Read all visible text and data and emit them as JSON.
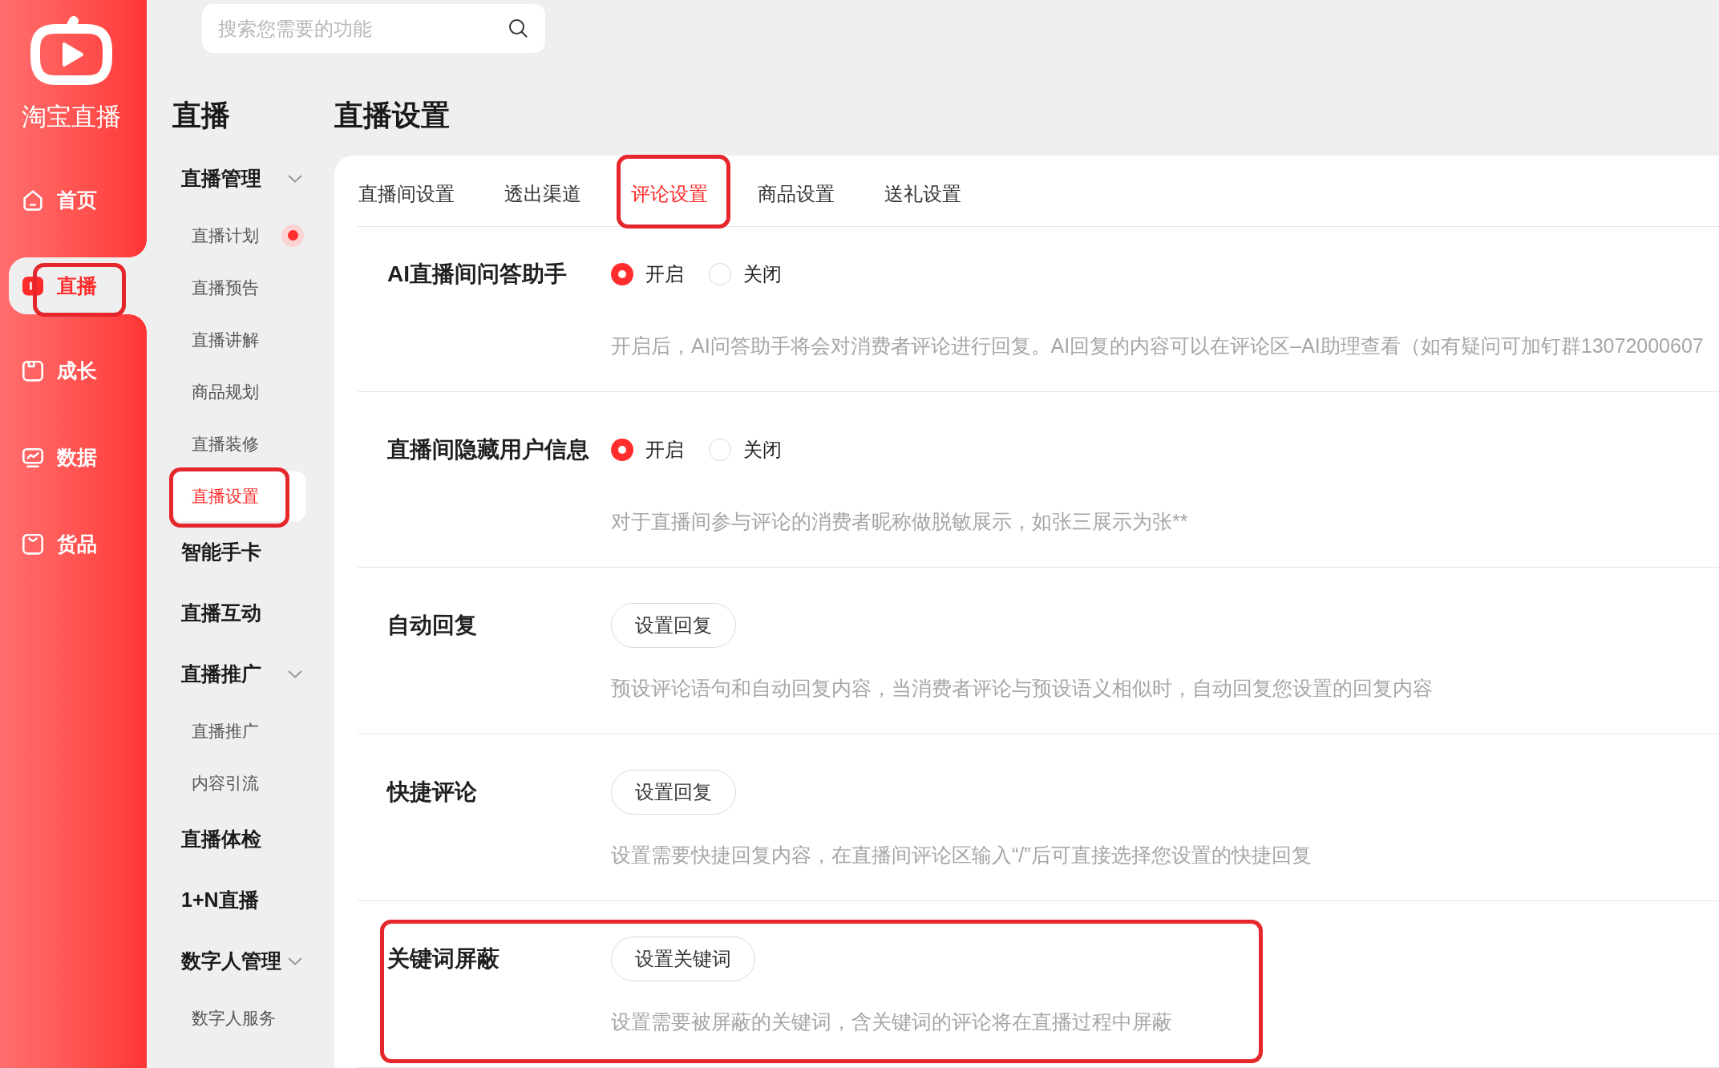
{
  "sidebar": {
    "logo_text": "淘宝直播",
    "items": [
      {
        "label": "首页",
        "selected": false,
        "highlighted": false
      },
      {
        "label": "直播",
        "selected": true,
        "highlighted": true
      },
      {
        "label": "成长",
        "selected": false,
        "highlighted": false
      },
      {
        "label": "数据",
        "selected": false,
        "highlighted": false
      },
      {
        "label": "货品",
        "selected": false,
        "highlighted": false
      }
    ]
  },
  "search": {
    "placeholder": "搜索您需要的功能"
  },
  "subnav": {
    "title": "直播",
    "groups": [
      {
        "label": "直播管理",
        "expanded": true,
        "items": [
          {
            "label": "直播计划",
            "selected": false,
            "highlighted": false,
            "dot": true
          },
          {
            "label": "直播预告",
            "selected": false,
            "highlighted": false,
            "dot": false
          },
          {
            "label": "直播讲解",
            "selected": false,
            "highlighted": false,
            "dot": false
          },
          {
            "label": "商品规划",
            "selected": false,
            "highlighted": false,
            "dot": false
          },
          {
            "label": "直播装修",
            "selected": false,
            "highlighted": false,
            "dot": false
          },
          {
            "label": "直播设置",
            "selected": true,
            "highlighted": true,
            "dot": false
          }
        ]
      },
      {
        "label": "智能手卡"
      },
      {
        "label": "直播互动"
      },
      {
        "label": "直播推广",
        "expanded": true,
        "items": [
          {
            "label": "直播推广",
            "selected": false,
            "highlighted": false,
            "dot": false
          },
          {
            "label": "内容引流",
            "selected": false,
            "highlighted": false,
            "dot": false
          }
        ]
      },
      {
        "label": "直播体检"
      },
      {
        "label": "1+N直播"
      },
      {
        "label": "数字人管理",
        "expanded": true,
        "items": [
          {
            "label": "数字人服务",
            "selected": false,
            "highlighted": false,
            "dot": false
          }
        ]
      }
    ]
  },
  "page": {
    "title": "直播设置"
  },
  "tabs": [
    {
      "label": "直播间设置",
      "selected": false,
      "highlighted": false
    },
    {
      "label": "透出渠道",
      "selected": false,
      "highlighted": false
    },
    {
      "label": "评论设置",
      "selected": true,
      "highlighted": true
    },
    {
      "label": "商品设置",
      "selected": false,
      "highlighted": false
    },
    {
      "label": "送礼设置",
      "selected": false,
      "highlighted": false
    }
  ],
  "settings": [
    {
      "kind": "radio",
      "label": "AI直播间问答助手",
      "options": [
        {
          "label": "开启",
          "selected": true
        },
        {
          "label": "关闭",
          "selected": false
        }
      ],
      "description": "开启后，AI问答助手将会对消费者评论进行回复。AI回复的内容可以在评论区–AI助理查看（如有疑问可加钉群13072000607",
      "highlighted": false
    },
    {
      "kind": "radio",
      "label": "直播间隐藏用户信息",
      "options": [
        {
          "label": "开启",
          "selected": true
        },
        {
          "label": "关闭",
          "selected": false
        }
      ],
      "description": "对于直播间参与评论的消费者昵称做脱敏展示，如张三展示为张**",
      "highlighted": false
    },
    {
      "kind": "button",
      "label": "自动回复",
      "button": "设置回复",
      "description": "预设评论语句和自动回复内容，当消费者评论与预设语义相似时，自动回复您设置的回复内容",
      "highlighted": false
    },
    {
      "kind": "button",
      "label": "快捷评论",
      "button": "设置回复",
      "description": "设置需要快捷回复内容，在直播间评论区输入“/”后可直接选择您设置的快捷回复",
      "highlighted": false
    },
    {
      "kind": "button",
      "label": "关键词屏蔽",
      "button": "设置关键词",
      "description": "设置需要被屏蔽的关键词，含关键词的评论将在直播过程中屏蔽",
      "highlighted": true
    }
  ]
}
